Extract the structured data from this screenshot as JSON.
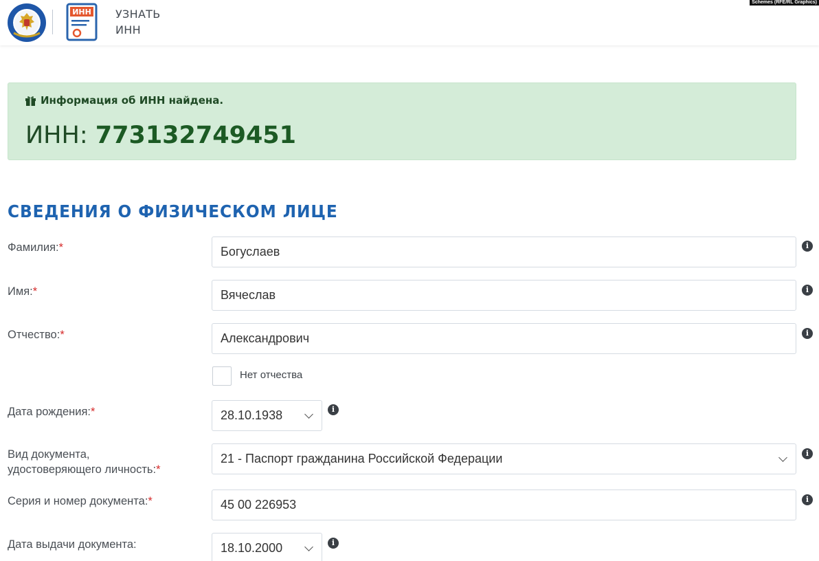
{
  "header": {
    "title_line1": "УЗНАТЬ",
    "title_line2": "ИНН",
    "inn_icon_text": "ИНН",
    "credit": "Schemes (RFE/RL Graphics)"
  },
  "alert": {
    "message": "Информация об ИНН найдена.",
    "inn_label": "ИНН:",
    "inn_value": "773132749451"
  },
  "section": {
    "title": "СВЕДЕНИЯ О ФИЗИЧЕСКОМ ЛИЦЕ"
  },
  "form": {
    "surname": {
      "label": "Фамилия:",
      "required": "*",
      "value": "Богуслаев"
    },
    "name": {
      "label": "Имя:",
      "required": "*",
      "value": "Вячеслав"
    },
    "patronymic": {
      "label": "Отчество:",
      "required": "*",
      "value": "Александрович"
    },
    "no_patronymic": {
      "label": "Нет отчества",
      "checked": false
    },
    "birth_date": {
      "label": "Дата рождения:",
      "required": "*",
      "value": "28.10.1938"
    },
    "doc_type": {
      "label_line1": "Вид документа,",
      "label_line2": "удостоверяющего личность:",
      "required": "*",
      "value": "21 - Паспорт гражданина Российской Федерации"
    },
    "doc_number": {
      "label": "Серия и номер документа:",
      "required": "*",
      "value": "45 00 226953"
    },
    "issue_date": {
      "label": "Дата выдачи документа:",
      "value": "18.10.2000"
    }
  },
  "icons": {
    "info": "i"
  },
  "colors": {
    "alert_bg": "#d4ecd8",
    "alert_text": "#1f4a25",
    "section_title": "#1e63b0",
    "required": "#d62b2b"
  }
}
